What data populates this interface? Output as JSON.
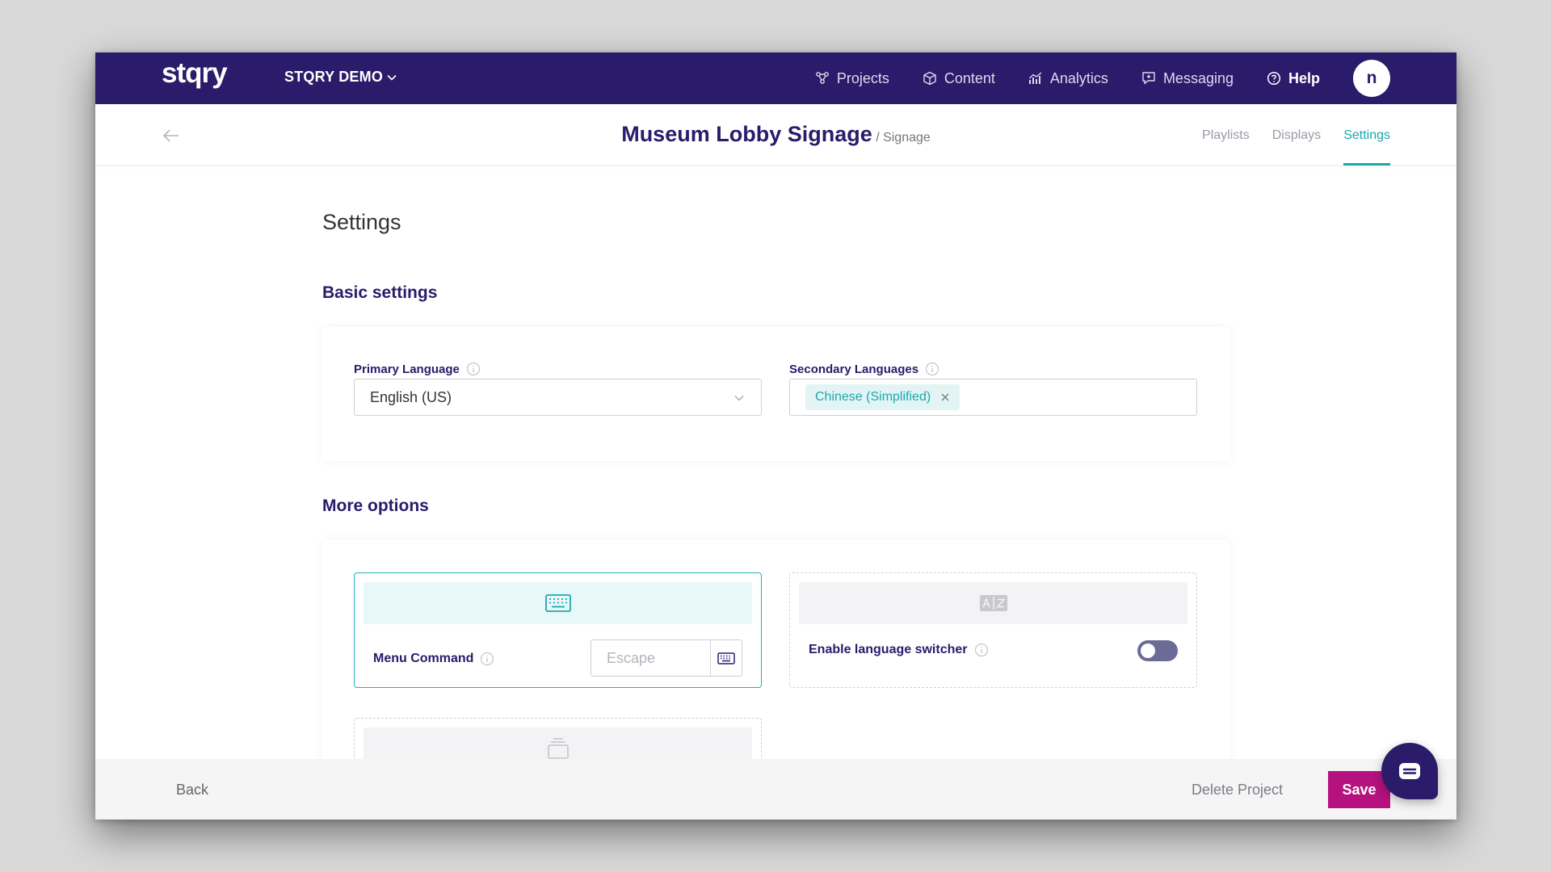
{
  "app": {
    "logo": "stqry",
    "org_name": "STQRY DEMO"
  },
  "nav": {
    "items": [
      {
        "label": "Projects",
        "icon": "projects-icon"
      },
      {
        "label": "Content",
        "icon": "box-icon"
      },
      {
        "label": "Analytics",
        "icon": "analytics-icon"
      },
      {
        "label": "Messaging",
        "icon": "messaging-icon"
      },
      {
        "label": "Help",
        "icon": "help-icon"
      }
    ],
    "avatar_initial": "n"
  },
  "header": {
    "title": "Museum Lobby Signage",
    "subtitle": "/ Signage",
    "tabs": [
      "Playlists",
      "Displays",
      "Settings"
    ],
    "active_tab": "Settings"
  },
  "page": {
    "heading": "Settings"
  },
  "basic_settings": {
    "heading": "Basic settings",
    "primary_language": {
      "label": "Primary Language",
      "value": "English (US)"
    },
    "secondary_languages": {
      "label": "Secondary Languages",
      "chips": [
        "Chinese (Simplified)"
      ]
    }
  },
  "more_options": {
    "heading": "More options",
    "menu_command": {
      "label": "Menu Command",
      "placeholder": "Escape",
      "icon": "keyboard-icon"
    },
    "language_switcher": {
      "label": "Enable language switcher",
      "enabled": false,
      "icon": "translate-icon"
    },
    "third_option": {
      "icon": "stack-icon"
    }
  },
  "footer": {
    "back_label": "Back",
    "delete_label": "Delete Project",
    "save_label": "Save"
  },
  "colors": {
    "nav_bg": "#2a1b6b",
    "accent_teal": "#1aa8b0",
    "save_magenta": "#b5127f"
  }
}
